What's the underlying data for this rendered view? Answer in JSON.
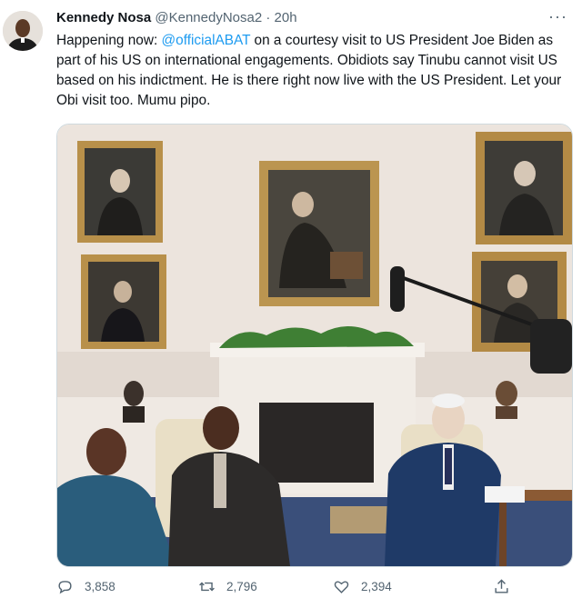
{
  "tweet": {
    "author_name": "Kennedy Nosa",
    "handle": "@KennedyNosa2",
    "separator": "·",
    "time": "20h",
    "more_label": "···",
    "text_pre": "Happening now: ",
    "mention": "@officialABAT",
    "text_post": " on a courtesy visit to US President Joe Biden as part of his US on international engagements. Obidiots say Tinubu cannot visit US based on his indictment. He is there right now live with the US President. Let your Obi visit too. Mumu pipo.",
    "media_alt": "Photo in the Oval Office with portraits and a fireplace"
  },
  "actions": {
    "replies": "3,858",
    "retweets": "2,796",
    "likes": "2,394"
  },
  "icons": {
    "reply": "reply-icon",
    "retweet": "retweet-icon",
    "like": "heart-icon",
    "share": "share-icon",
    "more": "more-icon"
  },
  "colors": {
    "accent": "#1d9bf0",
    "text": "#0f1419",
    "muted": "#536471"
  }
}
